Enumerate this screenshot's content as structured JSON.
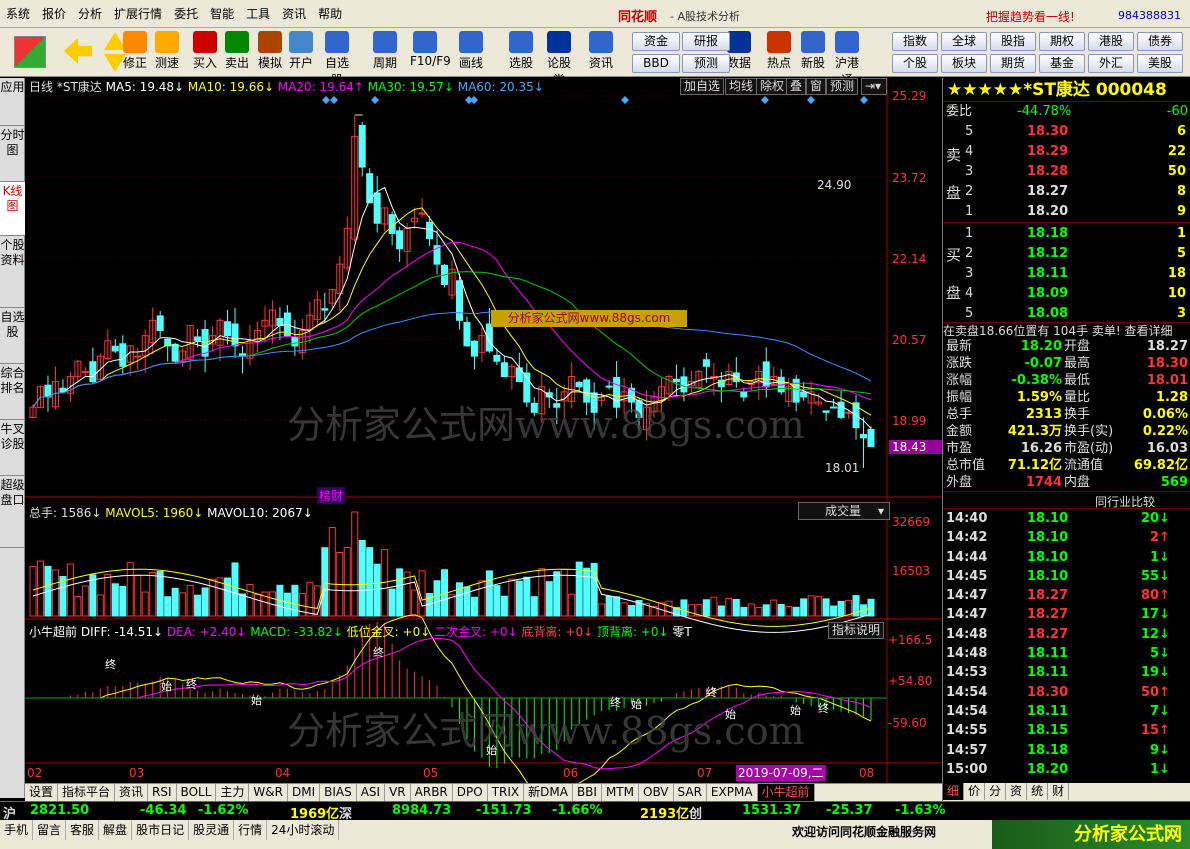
{
  "menu": {
    "items": [
      "系统",
      "报价",
      "分析",
      "扩展行情",
      "委托",
      "智能",
      "工具",
      "资讯",
      "帮助"
    ],
    "brand": "同花顺",
    "brand_sub": "- A股技术分析",
    "promo": "把握趋势看一线!",
    "phone": "984388831"
  },
  "toolbar": {
    "buttons": [
      "修正",
      "测速",
      "买入",
      "卖出",
      "模拟",
      "开户",
      "自选股",
      "周期",
      "F10/F9",
      "画线",
      "选股",
      "论股堂",
      "资讯",
      "数据",
      "热点",
      "新股",
      "沪港通"
    ],
    "mid_btns": [
      "资金",
      "研报",
      "BBD",
      "预测"
    ],
    "right_btns": [
      "指数",
      "全球",
      "股指",
      "期权",
      "港股",
      "债券",
      "个股",
      "板块",
      "期货",
      "基金",
      "外汇",
      "美股"
    ]
  },
  "side_tabs": [
    "应用",
    "分时图",
    "K线图",
    "个股资料",
    "自选股",
    "综合排名",
    "牛叉诊股",
    "超级盘口"
  ],
  "chart": {
    "header": {
      "type": "日线",
      "name": "*ST康达",
      "ma5": "MA5: 19.48↓",
      "ma10": "MA10: 19.66↓",
      "ma20": "MA20: 19.64↑",
      "ma30": "MA30: 19.57↓",
      "ma60": "MA60: 20.35↓"
    },
    "header_btns": [
      "加自选",
      "均线",
      "除权",
      "叠",
      "窗",
      "预测"
    ],
    "y_labels": [
      "25.29",
      "23.72",
      "22.14",
      "20.57",
      "18.99",
      "18.43"
    ],
    "hi_label": "24.90",
    "lo_label": "18.01",
    "badge": "榜财",
    "vol_legend": {
      "total": "总手: 1586↓",
      "mavol5": "MAVOL5: 1960↓",
      "mavol10": "MAVOL10: 2067↓"
    },
    "vol_select": "成交量",
    "vol_y": [
      "32669",
      "16503"
    ],
    "ind_legend": {
      "name": "小牛超前",
      "diff": "DIFF: -14.51↓",
      "dea": "DEA: +2.40↓",
      "macd": "MACD: -33.82↓",
      "a": "低位金叉: +0↓",
      "b": "二次金叉: +0↓",
      "c": "底背离: +0↓",
      "d": "顶背离: +0↓",
      "e": "零T"
    },
    "ind_btn": "指标说明",
    "ind_y": [
      "+166.5",
      "+54.80",
      "-59.60"
    ],
    "ind_marks": [
      "终",
      "始",
      "终",
      "始",
      "终",
      "始",
      "终",
      "始",
      "终",
      "始",
      "终",
      "始"
    ],
    "x_labels": [
      "02",
      "03",
      "04",
      "05",
      "06",
      "07",
      "08"
    ],
    "x_date": "2019-07-09,二",
    "watermark": "分析家公式网www.88gs.com",
    "banner": "分析家公式网www.88gs.com"
  },
  "chart_data": {
    "type": "candlestick",
    "title": "*ST康达 日线",
    "ylim": [
      17.9,
      25.29
    ],
    "y_ticks": [
      25.29,
      23.72,
      22.14,
      20.57,
      18.99
    ],
    "last_price": 18.43,
    "high": 24.9,
    "low": 18.01,
    "months": [
      "02",
      "03",
      "04",
      "05",
      "06",
      "07",
      "08"
    ],
    "close": [
      19.2,
      19.6,
      19.4,
      19.7,
      19.5,
      19.8,
      20.1,
      19.9,
      19.7,
      20.2,
      20.5,
      20.3,
      20.0,
      20.4,
      20.2,
      20.6,
      20.9,
      20.7,
      20.4,
      20.1,
      20.3,
      20.8,
      20.5,
      20.2,
      20.6,
      20.9,
      20.6,
      20.4,
      20.2,
      20.5,
      20.7,
      20.9,
      21.1,
      20.8,
      20.6,
      20.4,
      20.7,
      21.0,
      21.3,
      21.1,
      21.5,
      22.0,
      22.7,
      24.5,
      23.9,
      23.2,
      22.8,
      23.1,
      22.6,
      22.3,
      22.7,
      22.9,
      23.0,
      22.5,
      22.0,
      21.6,
      21.9,
      20.9,
      20.4,
      20.2,
      20.6,
      20.3,
      20.1,
      19.8,
      20.0,
      19.7,
      19.3,
      19.1,
      19.6,
      19.4,
      19.2,
      19.5,
      19.8,
      19.6,
      19.3,
      19.1,
      19.4,
      19.6,
      19.2,
      19.5,
      19.3,
      19.0,
      19.2,
      19.4,
      19.6,
      19.8,
      19.7,
      19.5,
      19.7,
      19.9,
      20.0,
      19.8,
      19.6,
      19.9,
      19.7,
      19.4,
      19.7,
      19.9,
      19.6,
      19.8,
      19.5,
      19.6,
      19.3,
      19.4,
      19.5,
      19.3,
      19.1,
      19.2,
      19.0,
      19.1,
      18.8,
      18.6,
      18.43
    ],
    "volume_max": 32669,
    "macd_range": [
      -170,
      166.5
    ]
  },
  "right": {
    "stars": "★★★★★",
    "name": "*ST康达",
    "code": "000048",
    "weibi_label": "委比",
    "weibi": "-44.78%",
    "weibi_r": "-60",
    "sell_label": [
      "卖",
      "盘"
    ],
    "buy_label": [
      "买",
      "盘"
    ],
    "sells": [
      [
        "5",
        "18.30",
        "6"
      ],
      [
        "4",
        "18.29",
        "22"
      ],
      [
        "3",
        "18.28",
        "50"
      ],
      [
        "2",
        "18.27",
        "8"
      ],
      [
        "1",
        "18.20",
        "9"
      ]
    ],
    "buys": [
      [
        "1",
        "18.18",
        "1"
      ],
      [
        "2",
        "18.12",
        "5"
      ],
      [
        "3",
        "18.11",
        "18"
      ],
      [
        "4",
        "18.09",
        "10"
      ],
      [
        "5",
        "18.08",
        "3"
      ]
    ],
    "info_line": "在卖盘18.66位置有  104手  卖单!  查看详细",
    "stats": [
      [
        "最新",
        "18.20",
        "开盘",
        "18.27"
      ],
      [
        "涨跌",
        "-0.07",
        "最高",
        "18.30"
      ],
      [
        "涨幅",
        "-0.38%",
        "最低",
        "18.01"
      ],
      [
        "振幅",
        "1.59%",
        "量比",
        "1.28"
      ],
      [
        "总手",
        "2313",
        "换手",
        "0.06%"
      ],
      [
        "金额",
        "421.3万",
        "换手(实)",
        "0.22%"
      ],
      [
        "市盈",
        "16.26",
        "市盈(动)",
        "16.03"
      ],
      [
        "总市值",
        "71.12亿",
        "流通值",
        "69.82亿"
      ],
      [
        "外盘",
        "1744",
        "内盘",
        "569"
      ]
    ],
    "compare_btn": "同行业比较",
    "ticks": [
      [
        "14:40",
        "18.10",
        "20↓"
      ],
      [
        "14:42",
        "18.10",
        "2↑"
      ],
      [
        "14:44",
        "18.10",
        "1↓"
      ],
      [
        "14:45",
        "18.10",
        "55↓"
      ],
      [
        "14:47",
        "18.27",
        "80↑"
      ],
      [
        "14:47",
        "18.27",
        "17↓"
      ],
      [
        "14:48",
        "18.27",
        "12↓"
      ],
      [
        "14:48",
        "18.11",
        "5↓"
      ],
      [
        "14:53",
        "18.11",
        "19↓"
      ],
      [
        "14:54",
        "18.30",
        "50↑"
      ],
      [
        "14:54",
        "18.11",
        "7↓"
      ],
      [
        "14:55",
        "18.15",
        "15↑"
      ],
      [
        "14:57",
        "18.18",
        "9↓"
      ],
      [
        "15:00",
        "18.20",
        "1↓"
      ]
    ],
    "bottom_tabs": [
      "细",
      "价",
      "分",
      "资",
      "统",
      "财"
    ]
  },
  "bottom_tabs": [
    "设置",
    "指标平台",
    "资讯",
    "RSI",
    "BOLL",
    "主力",
    "W&R",
    "DMI",
    "BIAS",
    "ASI",
    "VR",
    "ARBR",
    "DPO",
    "TRIX",
    "新DMA",
    "BBI",
    "MTM",
    "OBV",
    "SAR",
    "EXPMA",
    "小牛超前"
  ],
  "status": {
    "sh_label": "沪",
    "sh_val": "2821.50",
    "sh_chg": "-46.34",
    "sh_pct": "-1.62%",
    "sh_amt": "1969亿",
    "sz_label": "深",
    "sz_val": "8984.73",
    "sz_chg": "-151.73",
    "sz_pct": "-1.66%",
    "sz_amt": "2193亿",
    "cy_label": "创",
    "cy_val": "1531.37",
    "cy_chg": "-25.37",
    "cy_pct": "-1.63%"
  },
  "footer": {
    "items": [
      "手机",
      "留言",
      "客服",
      "解盘",
      "股市日记",
      "股灵通",
      "行情",
      "24小时滚动"
    ],
    "welcome": "欢迎访问同花顺金融服务网",
    "logo": "分析家公式网"
  }
}
